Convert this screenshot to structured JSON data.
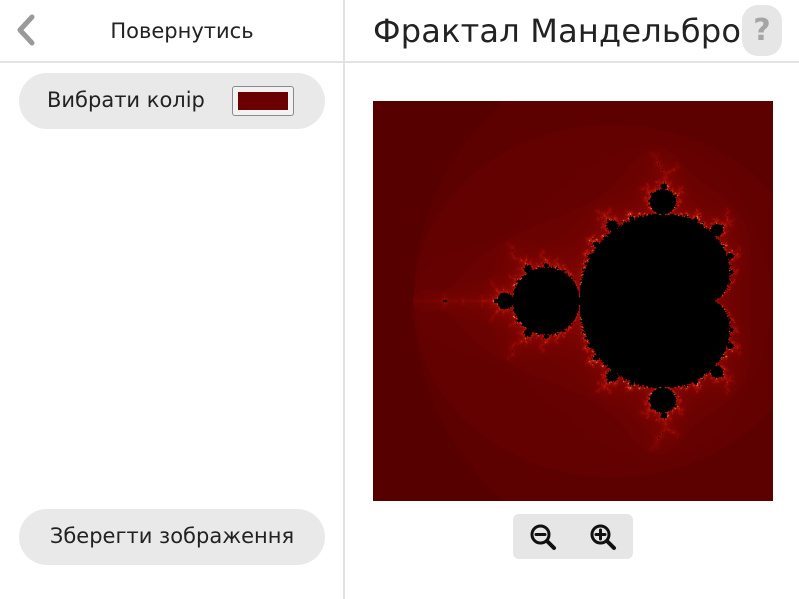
{
  "header": {
    "back_label": "Повернутись",
    "title": "Фрактал Мандельброта",
    "help_glyph": "?"
  },
  "sidebar": {
    "color_picker_label": "Вибрати колір",
    "selected_color": "#6b0000",
    "save_label": "Зберегти зображення"
  },
  "fractal": {
    "background_color": "#4a0000",
    "set_color": "#000000",
    "edge_glow_color": "#ff3b1a"
  },
  "zoom": {
    "zoom_out_icon": "zoom-out-icon",
    "zoom_in_icon": "zoom-in-icon"
  }
}
